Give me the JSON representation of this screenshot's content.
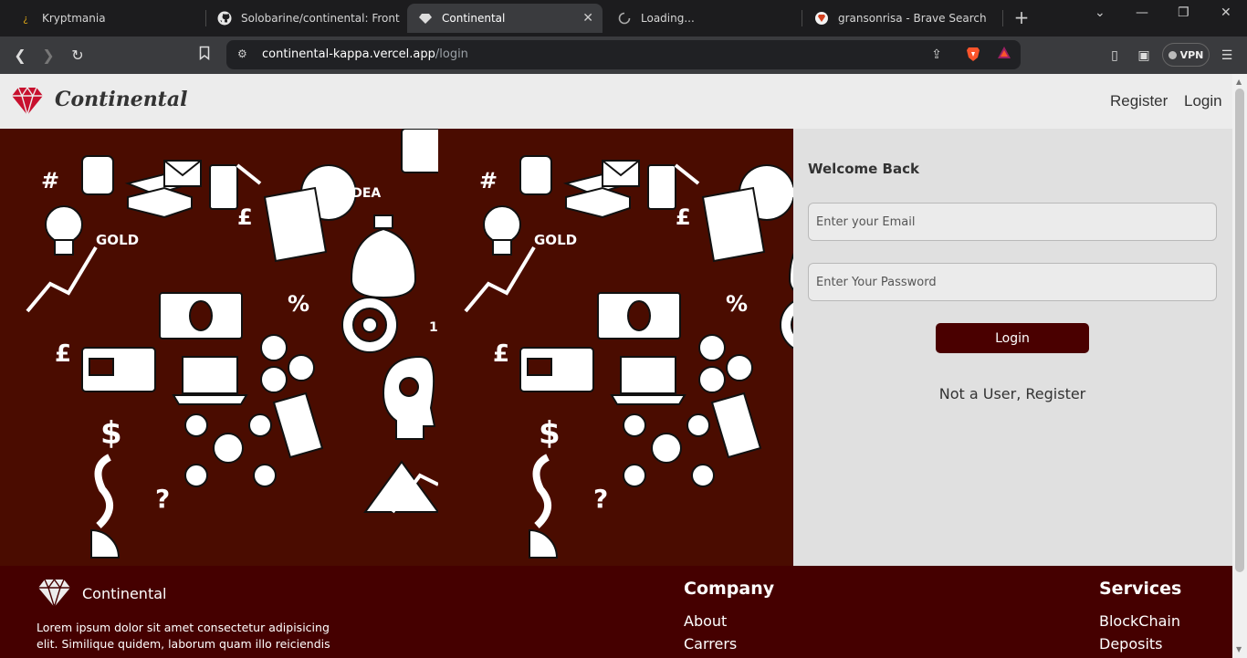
{
  "browser": {
    "tabs": [
      {
        "title": "Kryptmania",
        "icon": "kryptmania-favicon"
      },
      {
        "title": "Solobarine/continental: Front End",
        "icon": "github-icon"
      },
      {
        "title": "Continental",
        "icon": "diamond-icon"
      },
      {
        "title": "Loading...",
        "icon": "loading-spinner-icon"
      },
      {
        "title": "gransonrisa - Brave Search",
        "icon": "brave-search-icon"
      }
    ],
    "url_host": "continental-kappa.vercel.app",
    "url_path": "/login",
    "vpn_label": "VPN"
  },
  "header": {
    "brand": "Continental",
    "nav": {
      "register": "Register",
      "login": "Login"
    }
  },
  "login": {
    "heading": "Welcome Back",
    "email_placeholder": "Enter your Email",
    "password_placeholder": "Enter Your Password",
    "submit_label": "Login",
    "register_link": "Not a User, Register"
  },
  "footer": {
    "brand": "Continental",
    "text": "Lorem ipsum dolor sit amet consectetur adipisicing elit. Similique quidem, laborum quam illo reiciendis",
    "company": {
      "heading": "Company",
      "links": [
        "About",
        "Carrers"
      ]
    },
    "services": {
      "heading": "Services",
      "links": [
        "BlockChain",
        "Deposits"
      ]
    }
  },
  "colors": {
    "accent": "#4a0000",
    "footer": "#450000",
    "hero": "#4a0c00",
    "logo": "#c8102e"
  }
}
